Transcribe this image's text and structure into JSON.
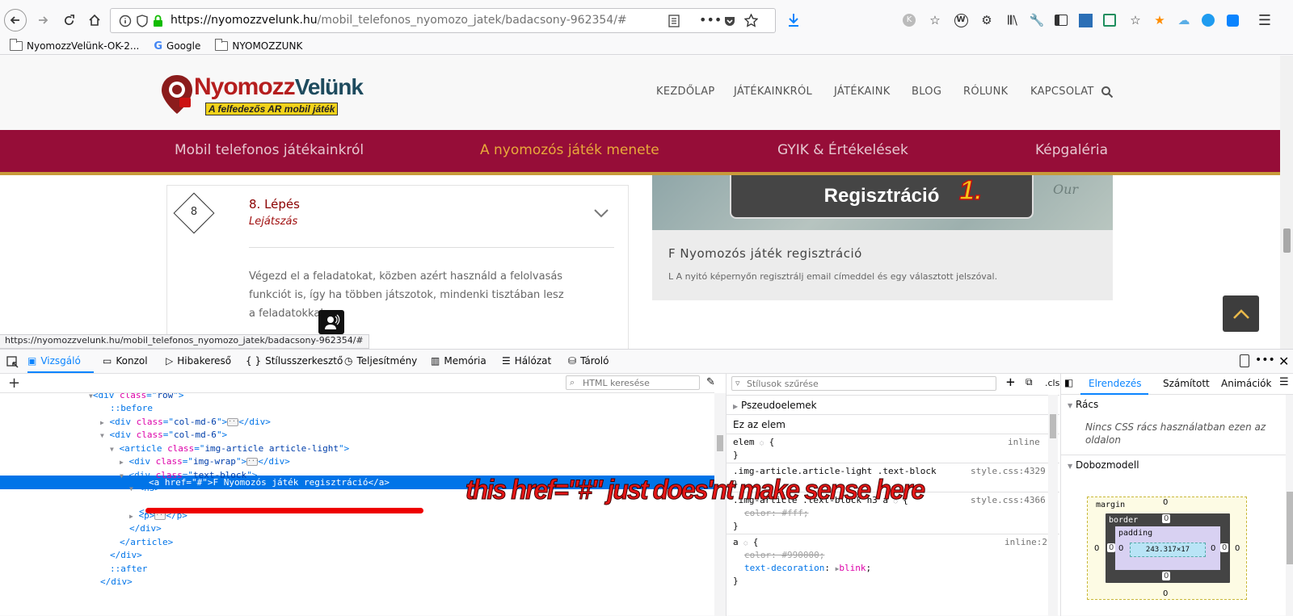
{
  "browser": {
    "url_host": "https://nyomozzvelunk.hu",
    "url_path": "/mobil_telefonos_nyomozo_jatek/badacsony-962354/#",
    "bookmarks": [
      "NyomozzVelünk-OK-2...",
      "Google",
      "NYOMOZZUNK"
    ]
  },
  "site": {
    "logo_main": "Nyomozz",
    "logo_accent": "Velünk",
    "logo_tagline": "A felfedezős AR mobil játék",
    "nav": [
      "KEZDŐLAP",
      "JÁTÉKAINKRÓL",
      "JÁTÉKAINK",
      "BLOG",
      "RÓLUNK",
      "KAPCSOLAT"
    ],
    "subnav": [
      "Mobil telefonos játékainkról",
      "A nyomozós játék menete",
      "GYIK & Értékelések",
      "Képgaléria"
    ]
  },
  "step": {
    "number": "8",
    "title": "8. Lépés",
    "subtitle": "Lejátszás",
    "body": "Végezd el a feladatokat, közben azért használd a felolvasás funkciót is, így ha többen játszotok, mindenki tisztában lesz a feladatokkal."
  },
  "reg_card": {
    "button_label": "Regisztráció",
    "annotation": "1.",
    "title": "F Nyomozós játék regisztráció",
    "desc": "L A nyitó képernyőn regisztrálj email címeddel és egy választott jelszóval."
  },
  "status_url": "https://nyomozzvelunk.hu/mobil_telefonos_nyomozo_jatek/badacsony-962354/#",
  "devtools": {
    "tabs": [
      "Vizsgáló",
      "Konzol",
      "Hibakereső",
      "Stílusszerkesztő",
      "Teljesítmény",
      "Memória",
      "Hálózat",
      "Tároló"
    ],
    "html_search_placeholder": "HTML keresése",
    "style_filter_placeholder": "Stílusok szűrése",
    "cls_label": ".cls",
    "markup": {
      "l0": {
        "tag": "div",
        "attr": "class",
        "val": "row"
      },
      "l1": "::before",
      "l2": {
        "tag": "div",
        "attr": "class",
        "val": "col-md-6"
      },
      "l3": {
        "tag": "div",
        "attr": "class",
        "val": "col-md-6"
      },
      "l4": {
        "tag": "article",
        "attr": "class",
        "val": "img-article article-light"
      },
      "l5": {
        "tag": "div",
        "attr": "class",
        "val": "img-wrap"
      },
      "l6": {
        "tag": "div",
        "attr": "class",
        "val": "text-block"
      },
      "l7": "<h3>",
      "l8": "<a href=\"#\">F Nyomozós játék regisztráció</a>",
      "l9": "</h3>",
      "l10": "<p>",
      "l11": "</div>",
      "l12": "</article>",
      "l13": "</div>",
      "l14": "::after",
      "l15": "</div>"
    },
    "rules": {
      "pseudo": "Pszeudoelemek",
      "this_elem": "Ez az elem",
      "r1_sel": "elem",
      "r1_src": "inline",
      "r2_sel": ".img-article.article-light .text-block",
      "r2_src": "style.css:4329",
      "r3_sel": ".img-article .text-block h3 a",
      "r3_src": "style.css:4366",
      "r3_prop": "color",
      "r3_val": "#fff",
      "r4_sel": "a",
      "r4_src": "inline:2",
      "r4_prop1": "color",
      "r4_val1": "#990000",
      "r4_prop2": "text-decoration",
      "r4_val2": "blink"
    },
    "layout_tabs": [
      "Elrendezés",
      "Számított",
      "Animációk"
    ],
    "grid_header": "Rács",
    "grid_empty": "Nincs CSS rács használatban ezen az oldalon",
    "boxmodel_header": "Dobozmodell",
    "box": {
      "margin_label": "margin",
      "border_label": "border",
      "padding_label": "padding",
      "content_size": "243.317×17",
      "zero": "0"
    }
  },
  "annotation_text": "this href=\"#\" just does'nt make sense here",
  "colors": {
    "brand_maroon": "#960d38",
    "subnav_active": "#e8a93a",
    "devtools_accent": "#0a84ff",
    "annotation_red": "#e41616"
  }
}
